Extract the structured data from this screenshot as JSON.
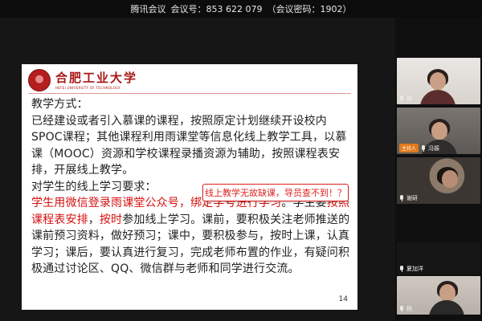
{
  "topbar": {
    "app_name": "腾讯会议",
    "meeting_id_label": "会议号：",
    "meeting_id": "853 622 079",
    "password": "（会议密码：1902）"
  },
  "slide": {
    "school_name_cn": "合肥工业大学",
    "school_name_en": "HEFEI UNIVERSITY OF TECHNOLOGY",
    "heading_method": "教学方式：",
    "para1": "已经建设或者引入慕课的课程，按照原定计划继续开设校内SPOC课程；其他课程利用雨课堂等信息化线上教学工具，以慕课（MOOC）资源和学校课程录播资源为辅助，按照课程表安排，开展线上教学。",
    "heading_req": "对学生的线上学习要求：",
    "para2_red1": "学生用微信登录雨课堂公众号，绑定学号进行学习",
    "para2_t1": "。学生要",
    "para2_red2": "按照课程表安排",
    "para2_t2": "，",
    "para2_red3": "按时",
    "para2_t3": "参加线上学习。课前，要积极关注老师推送的课前预习资料，做好预习；课中，要积极参与，按时上课，认真学习；课后，要认真进行复习，完成老师布置的作业，有疑问积极通过讨论区、QQ、微信群与老师和同学进行交流。",
    "page_number": "14"
  },
  "callout": {
    "text": "线上教学无故缺课，导员查不到！？"
  },
  "participants": [
    {
      "name": "锡",
      "host": false,
      "icon": "mic-icon"
    },
    {
      "name": "冯振",
      "host": true,
      "host_label": "主持人",
      "icon": "mic-icon"
    },
    {
      "name": "谢研",
      "host": false,
      "icon": "mic-icon"
    },
    {
      "name": "夏加洋",
      "host": false,
      "icon": "mic-icon"
    },
    {
      "name": "杨",
      "host": false,
      "icon": "mic-icon"
    }
  ],
  "colors": {
    "accent_red": "#d40f0f",
    "brand_red": "#a81616",
    "host_orange": "#e07a1b"
  }
}
